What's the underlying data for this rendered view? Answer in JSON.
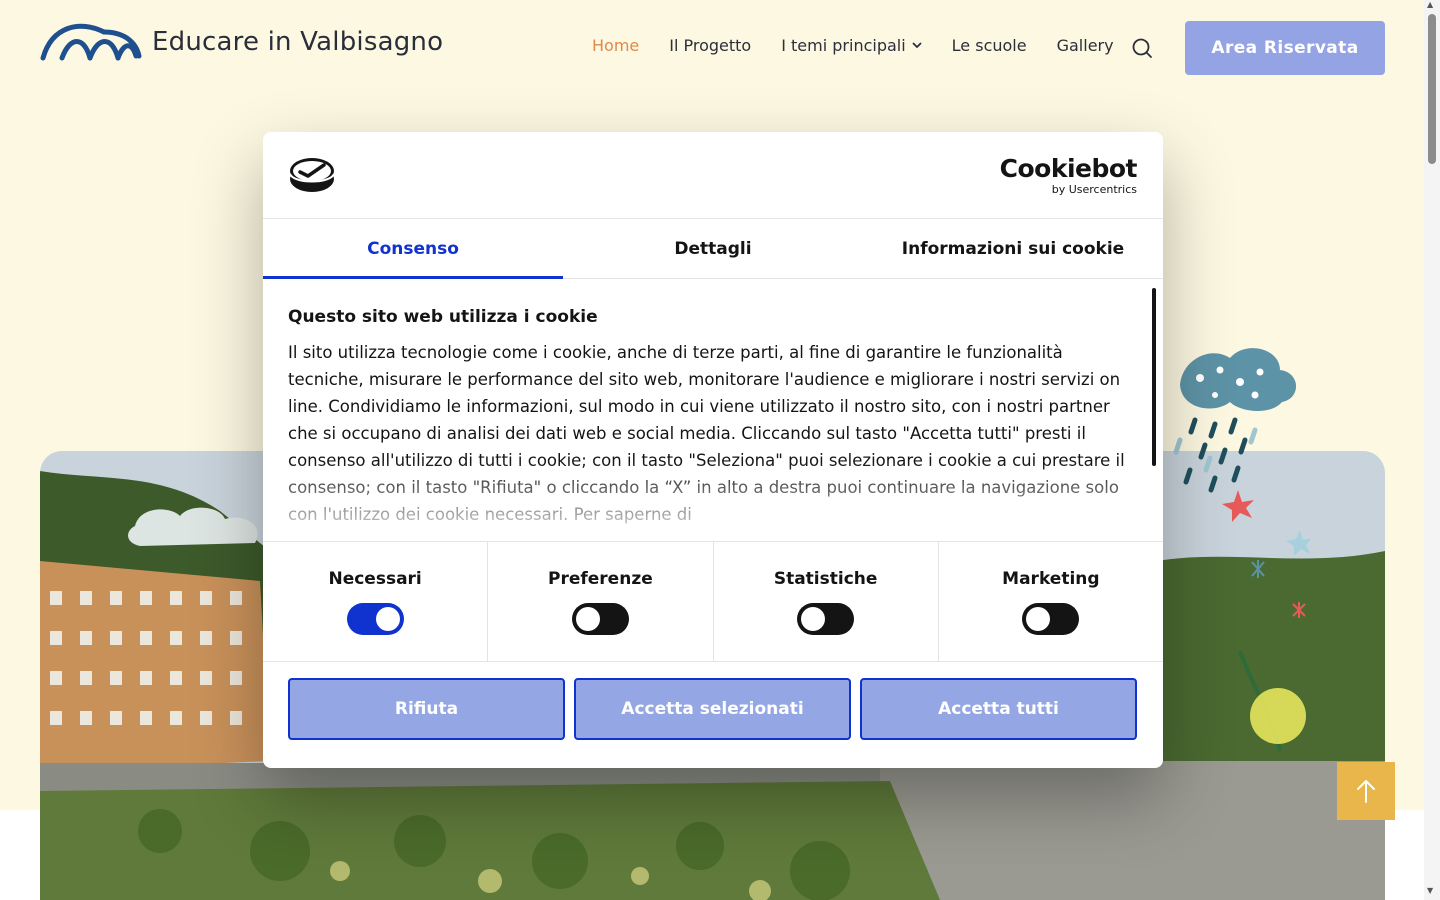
{
  "header": {
    "logo_text": "Educare in Valbisagno",
    "nav": [
      {
        "label": "Home",
        "active": true
      },
      {
        "label": "Il Progetto"
      },
      {
        "label": "I temi principali",
        "dropdown": true
      },
      {
        "label": "Le scuole"
      },
      {
        "label": "Gallery"
      }
    ],
    "search_icon": "search-icon",
    "reserved_button": "Area Riservata"
  },
  "colors": {
    "page_background": "#fdf8e1",
    "nav_active": "#e08a4a",
    "button_light_blue": "#94a3e3",
    "cookiebot_blue": "#1032cf",
    "back_to_top": "#e8b64a"
  },
  "cookie_dialog": {
    "brand": "Cookiebot",
    "brand_sub": "by Usercentrics",
    "tabs": [
      {
        "label": "Consenso",
        "active": true
      },
      {
        "label": "Dettagli"
      },
      {
        "label": "Informazioni sui cookie"
      }
    ],
    "title": "Questo sito web utilizza i cookie",
    "body": "Il sito utilizza tecnologie come i cookie, anche di terze parti, al fine di garantire le funzionalità tecniche, misurare le performance del sito web, monitorare l'audience e migliorare i nostri servizi on line. Condividiamo le informazioni, sul modo in cui viene utilizzato il nostro sito, con i nostri partner che si occupano di analisi dei dati web e social media. Cliccando sul tasto \"Accetta tutti\" presti il consenso all'utilizzo di tutti i cookie; con il tasto \"Seleziona\" puoi selezionare i cookie a cui prestare il consenso; con il tasto \"Rifiuta\" o cliccando la “X” in alto a destra puoi continuare la navigazione solo con l'utilizzo dei cookie necessari. Per saperne di",
    "toggles": [
      {
        "label": "Necessari",
        "on": true
      },
      {
        "label": "Preferenze",
        "on": false
      },
      {
        "label": "Statistiche",
        "on": false
      },
      {
        "label": "Marketing",
        "on": false
      }
    ],
    "buttons": {
      "reject": "Rifiuta",
      "accept_selected": "Accetta selezionati",
      "accept_all": "Accetta tutti"
    }
  },
  "back_to_top_icon": "arrow-up-icon"
}
